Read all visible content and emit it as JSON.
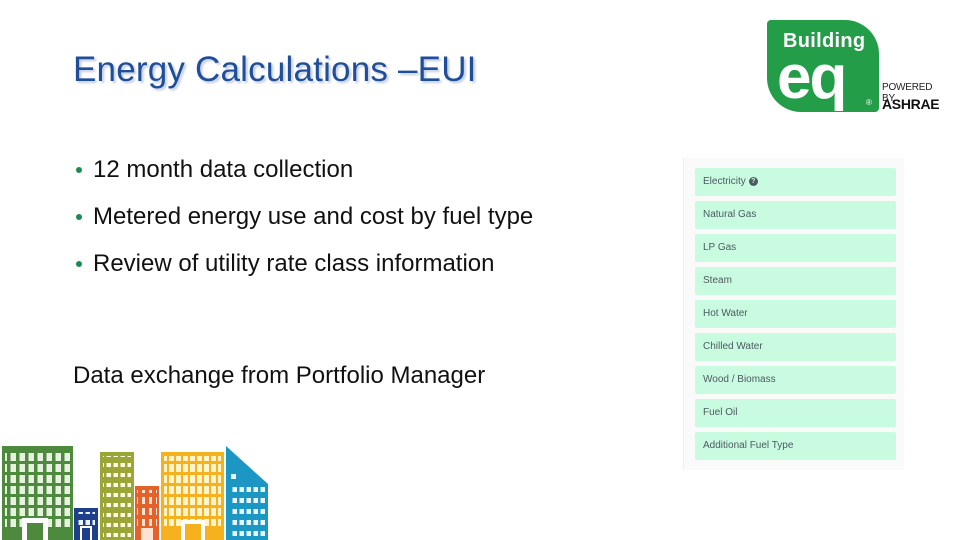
{
  "slide": {
    "title": "Energy Calculations –EUI",
    "bullets": [
      "12 month data collection",
      "Metered energy use and cost by fuel type",
      "Review of utility rate class information"
    ],
    "exchange_text": "Data exchange from Portfolio Manager"
  },
  "logo": {
    "word_top": "Building",
    "word_main": "eQ",
    "registered": "®",
    "powered_by": "POWERED BY",
    "org": "ASHRAE"
  },
  "fuel_panel": {
    "help_icon": "?",
    "items": [
      "Electricity",
      "Natural Gas",
      "LP Gas",
      "Steam",
      "Hot Water",
      "Chilled Water",
      "Wood / Biomass",
      "Fuel Oil",
      "Additional Fuel Type"
    ]
  },
  "colors": {
    "title": "#1f4e9a",
    "bullet": "#1d8a4f",
    "logo_green": "#239d48",
    "fuel_item_bg": "#c9fbe0",
    "skyline": [
      "#4e8a3e",
      "#1f3f8a",
      "#9aa637",
      "#e4622a",
      "#f5b21e",
      "#1c96c3"
    ]
  }
}
